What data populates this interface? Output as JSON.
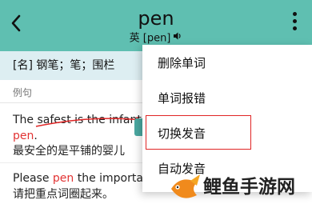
{
  "header": {
    "back_icon": "chevron-left-icon",
    "word": "pen",
    "phonetic": "英 [pen]",
    "speaker_icon": "speaker-icon",
    "more_icon": "more-vertical-icon",
    "bg_color": "#5fbfb1"
  },
  "definition": {
    "text": "[名] 钢笔；笔；围栏"
  },
  "examples": {
    "section_label": "例句",
    "ex1": {
      "en_prefix": "The safest is the infant",
      "en_highlight": "pen",
      "en_suffix": ".",
      "zh": "最安全的是平铺的婴儿"
    },
    "ex2": {
      "en_prefix": "Please ",
      "en_highlight": "pen",
      "en_suffix": " the importa",
      "zh": "请把重点词圈起来。"
    }
  },
  "menu": {
    "items": [
      {
        "label": "删除单词"
      },
      {
        "label": "单词报错"
      },
      {
        "label": "切换发音"
      },
      {
        "label": "自动发音"
      }
    ],
    "highlight_color": "#e02525"
  },
  "watermark": {
    "text": "鲤鱼手游网",
    "logo_icon": "carp-fish-logo-icon"
  },
  "colors": {
    "accent": "#5fbfb1",
    "highlight": "#e23333",
    "def_bg": "#ddeef2"
  }
}
